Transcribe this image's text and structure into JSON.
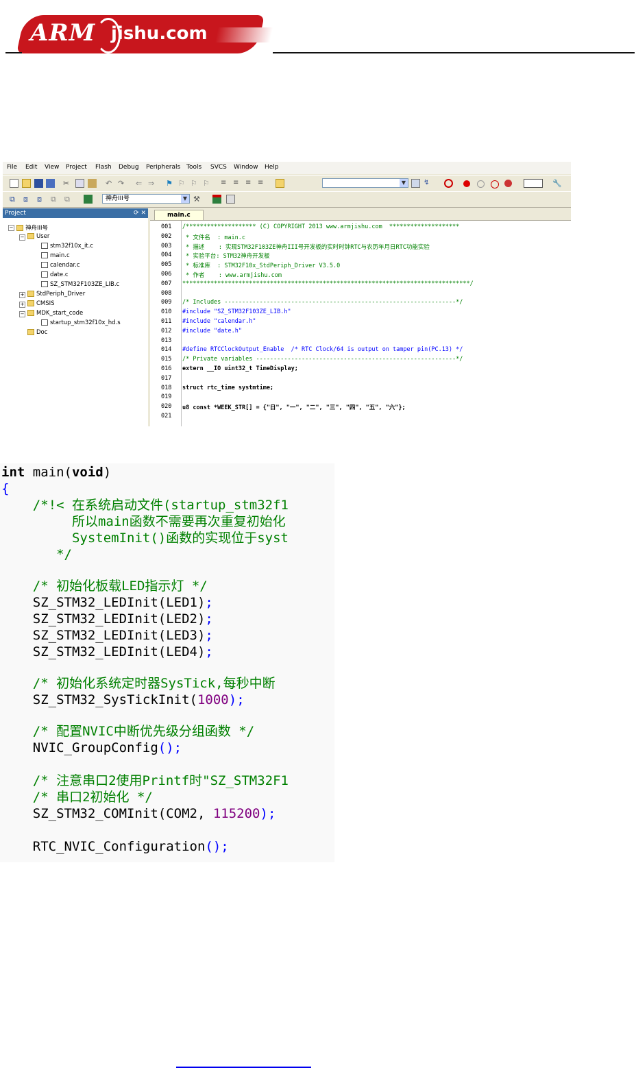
{
  "header": {
    "logo": "ARMjishu.com"
  },
  "ide": {
    "menu": [
      "File",
      "Edit",
      "View",
      "Project",
      "Flash",
      "Debug",
      "Peripherals",
      "Tools",
      "SVCS",
      "Window",
      "Help"
    ],
    "target_select": "神舟III号",
    "project_panel_title": "Project",
    "tree": {
      "root": "神舟III号",
      "group_user": "User",
      "user_files": [
        "stm32f10x_it.c",
        "main.c",
        "calendar.c",
        "date.c",
        "SZ_STM32F103ZE_LIB.c"
      ],
      "group_stdperiph": "StdPeriph_Driver",
      "group_cmsis": "CMSIS",
      "group_mdk": "MDK_start_code",
      "mdk_files": [
        "startup_stm32f10x_hd.s"
      ],
      "group_doc": "Doc"
    },
    "tab": "main.c",
    "lines": [
      {
        "n": "001",
        "t": "/******************** (C) COPYRIGHT 2013 www.armjishu.com  ********************",
        "c": "cm"
      },
      {
        "n": "002",
        "t": " * 文件名  : main.c",
        "c": "cm"
      },
      {
        "n": "003",
        "t": " * 描述    : 实现STM32F103ZE神舟III号开发板的实时时钟RTC与农历年月日RTC功能实验",
        "c": "cm"
      },
      {
        "n": "004",
        "t": " * 实验平台: STM32神舟开发板",
        "c": "cm"
      },
      {
        "n": "005",
        "t": " * 标准库  : STM32F10x_StdPeriph_Driver V3.5.0",
        "c": "cm"
      },
      {
        "n": "006",
        "t": " * 作者    : www.armjishu.com",
        "c": "cm"
      },
      {
        "n": "007",
        "t": "**********************************************************************************/",
        "c": "cm"
      },
      {
        "n": "008",
        "t": "",
        "c": "cm"
      },
      {
        "n": "009",
        "t": "/* Includes ------------------------------------------------------------------*/",
        "c": "cm"
      },
      {
        "n": "010",
        "t": "#include \"SZ_STM32F103ZE_LIB.h\"",
        "c": "pp"
      },
      {
        "n": "011",
        "t": "#include \"calendar.h\"",
        "c": "pp"
      },
      {
        "n": "012",
        "t": "#include \"date.h\"",
        "c": "pp"
      },
      {
        "n": "013",
        "t": "",
        "c": "cm"
      },
      {
        "n": "014",
        "t": "#define RTCClockOutput_Enable  /* RTC Clock/64 is output on tamper pin(PC.13) */",
        "c": "pp"
      },
      {
        "n": "015",
        "t": "/* Private variables ---------------------------------------------------------*/",
        "c": "cm"
      },
      {
        "n": "016",
        "t": "extern __IO uint32_t TimeDisplay;",
        "c": "kw"
      },
      {
        "n": "017",
        "t": "",
        "c": "cm"
      },
      {
        "n": "018",
        "t": "struct rtc_time systmtime;",
        "c": "kw"
      },
      {
        "n": "019",
        "t": "",
        "c": "cm"
      },
      {
        "n": "020",
        "t": "u8 const *WEEK_STR[] = {\"日\", \"一\", \"二\", \"三\", \"四\", \"五\", \"六\"};",
        "c": "kw"
      },
      {
        "n": "021",
        "t": "",
        "c": "cm"
      }
    ]
  },
  "code": {
    "l1_kw1": "int",
    "l1_rest": " main(",
    "l1_kw2": "void",
    "l1_close": ")",
    "l2": "{",
    "l3": "    /*!< 在系统启动文件(startup_stm32f1",
    "l4": "         所以main函数不需要再次重复初始化",
    "l5": "         SystemInit()函数的实现位于syst",
    "l6": "       */",
    "l8": "    /* 初始化板载LED指示灯 */",
    "l9": "    SZ_STM32_LEDInit(LED1)",
    "l10": "    SZ_STM32_LEDInit(LED2)",
    "l11": "    SZ_STM32_LEDInit(LED3)",
    "l12": "    SZ_STM32_LEDInit(LED4)",
    "l14": "    /* 初始化系统定时器SysTick,每秒中断",
    "l15a": "    SZ_STM32_SysTickInit(",
    "l15n": "1000",
    "l15b": ");",
    "l17": "    /* 配置NVIC中断优先级分组函数 */",
    "l18a": "    NVIC_GroupConfig",
    "l18b": "();",
    "l20": "    /* 注意串口2使用Printf时\"SZ_STM32F1",
    "l21": "    /* 串口2初始化 */",
    "l22a": "    SZ_STM32_COMInit(COM2, ",
    "l22n": "115200",
    "l22b": ");",
    "l24a": "    RTC_NVIC_Configuration",
    "l24b": "();",
    "semi": ";"
  }
}
